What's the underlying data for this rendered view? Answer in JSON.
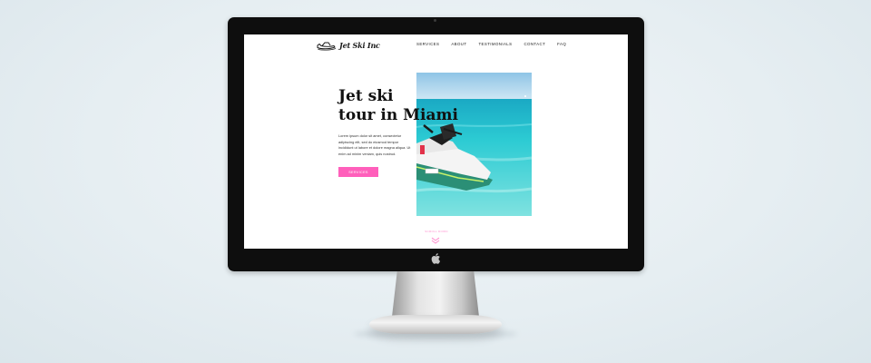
{
  "site": {
    "logo_text": "Jet Ski Inc",
    "nav": [
      {
        "label": "SERVICES"
      },
      {
        "label": "ABOUT"
      },
      {
        "label": "TESTIMONIALS"
      },
      {
        "label": "CONTACT"
      },
      {
        "label": "FAQ"
      }
    ]
  },
  "hero": {
    "title_line1": "Jet ski",
    "title_line2_prefix": "tour in ",
    "title_highlight": "Miami",
    "body": "Lorem ipsum dolor sit amet, consectetur adipiscing elit, sed do eiusmod tempor incididunt ut labore et dolore magna aliqua. Ut enim ad minim veniam, quis nostrud.",
    "cta_label": "SERVICES"
  },
  "scroll": {
    "label": "SCROLL DOWN",
    "icon": "scroll-down-icon"
  },
  "colors": {
    "accent": "#ff5fbb",
    "text": "#111111",
    "sea": "#2cc6cf",
    "sky": "#a9d6ee"
  }
}
